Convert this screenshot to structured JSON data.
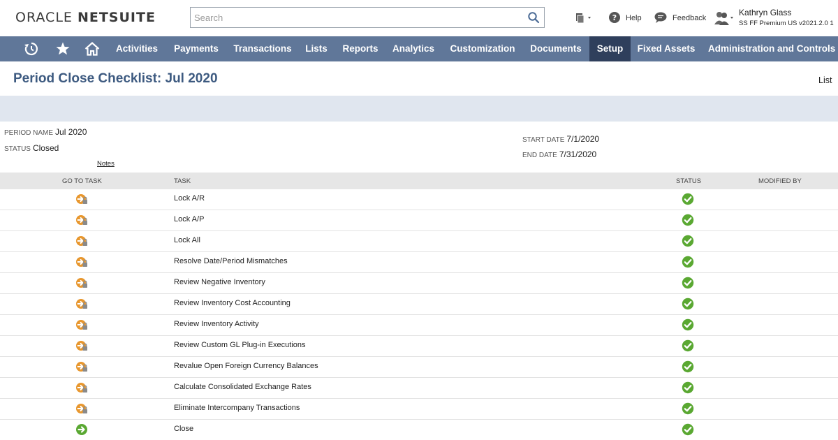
{
  "header": {
    "logo_part1": "ORACLE",
    "logo_part2": "NETSUITE",
    "search_placeholder": "Search",
    "help_label": "Help",
    "feedback_label": "Feedback",
    "user_name": "Kathryn Glass",
    "user_role": "SS FF Premium US v2021.2.0 1"
  },
  "nav": {
    "icons": [
      "recent-records-icon",
      "star-icon",
      "home-icon"
    ],
    "items": [
      "Activities",
      "Payments",
      "Transactions",
      "Lists",
      "Reports",
      "Analytics",
      "Customization",
      "Documents",
      "Setup",
      "Fixed Assets",
      "Administration and Controls"
    ],
    "active_item": "Setup",
    "bar_color": "#607799",
    "active_color": "#2f3f5c"
  },
  "page": {
    "title": "Period Close Checklist: Jul 2020",
    "list_link": "List"
  },
  "fields": {
    "period_name_label": "PERIOD NAME",
    "period_name_value": "Jul 2020",
    "status_label": "STATUS",
    "status_value": "Closed",
    "notes_link": "Notes",
    "start_date_label": "START DATE",
    "start_date_value": "7/1/2020",
    "end_date_label": "END DATE",
    "end_date_value": "7/31/2020"
  },
  "table": {
    "columns": [
      "GO TO TASK",
      "TASK",
      "STATUS",
      "MODIFIED BY"
    ],
    "rows": [
      {
        "task": "Lock A/R",
        "goto_icon": "locked-task-icon",
        "status_icon": "check-circle-icon",
        "modified_by": ""
      },
      {
        "task": "Lock A/P",
        "goto_icon": "locked-task-icon",
        "status_icon": "check-circle-icon",
        "modified_by": ""
      },
      {
        "task": "Lock All",
        "goto_icon": "locked-task-icon",
        "status_icon": "check-circle-icon",
        "modified_by": ""
      },
      {
        "task": "Resolve Date/Period Mismatches",
        "goto_icon": "locked-task-icon",
        "status_icon": "check-circle-icon",
        "modified_by": ""
      },
      {
        "task": "Review Negative Inventory",
        "goto_icon": "locked-task-icon",
        "status_icon": "check-circle-icon",
        "modified_by": ""
      },
      {
        "task": "Review Inventory Cost Accounting",
        "goto_icon": "locked-task-icon",
        "status_icon": "check-circle-icon",
        "modified_by": ""
      },
      {
        "task": "Review Inventory Activity",
        "goto_icon": "locked-task-icon",
        "status_icon": "check-circle-icon",
        "modified_by": ""
      },
      {
        "task": "Review Custom GL Plug-in Executions",
        "goto_icon": "locked-task-icon",
        "status_icon": "check-circle-icon",
        "modified_by": ""
      },
      {
        "task": "Revalue Open Foreign Currency Balances",
        "goto_icon": "locked-task-icon",
        "status_icon": "check-circle-icon",
        "modified_by": ""
      },
      {
        "task": "Calculate Consolidated Exchange Rates",
        "goto_icon": "locked-task-icon",
        "status_icon": "check-circle-icon",
        "modified_by": ""
      },
      {
        "task": "Eliminate Intercompany Transactions",
        "goto_icon": "locked-task-icon",
        "status_icon": "check-circle-icon",
        "modified_by": ""
      },
      {
        "task": "Close",
        "goto_icon": "go-arrow-icon",
        "status_icon": "check-circle-icon",
        "modified_by": ""
      }
    ],
    "colors": {
      "header_bg": "#e6e6e6",
      "check_green": "#5aa832",
      "lock_orange": "#e8972e"
    }
  }
}
